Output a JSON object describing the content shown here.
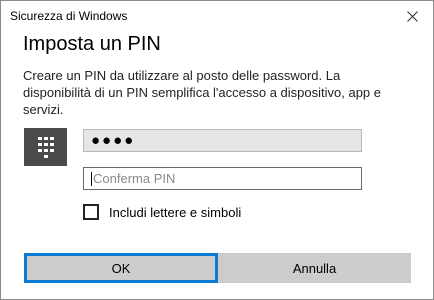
{
  "window": {
    "title": "Sicurezza di Windows",
    "close_icon": "close-icon"
  },
  "dialog": {
    "heading": "Imposta un PIN",
    "description": "Creare un PIN da utilizzare al posto delle password. La disponibilità di un PIN semplifica l'accesso a dispositivo, app e servizi.",
    "pin_icon": "keypad-icon",
    "pin_field": {
      "value_masked": "●●●●"
    },
    "confirm_field": {
      "placeholder": "Conferma PIN",
      "value": ""
    },
    "checkbox": {
      "label": "Includi lettere e simboli",
      "checked": false
    },
    "buttons": {
      "ok": "OK",
      "cancel": "Annulla"
    }
  },
  "colors": {
    "accent_focus": "#0a7ad4",
    "button_bg": "#cccccc",
    "tile_bg": "#4a4a4a"
  }
}
